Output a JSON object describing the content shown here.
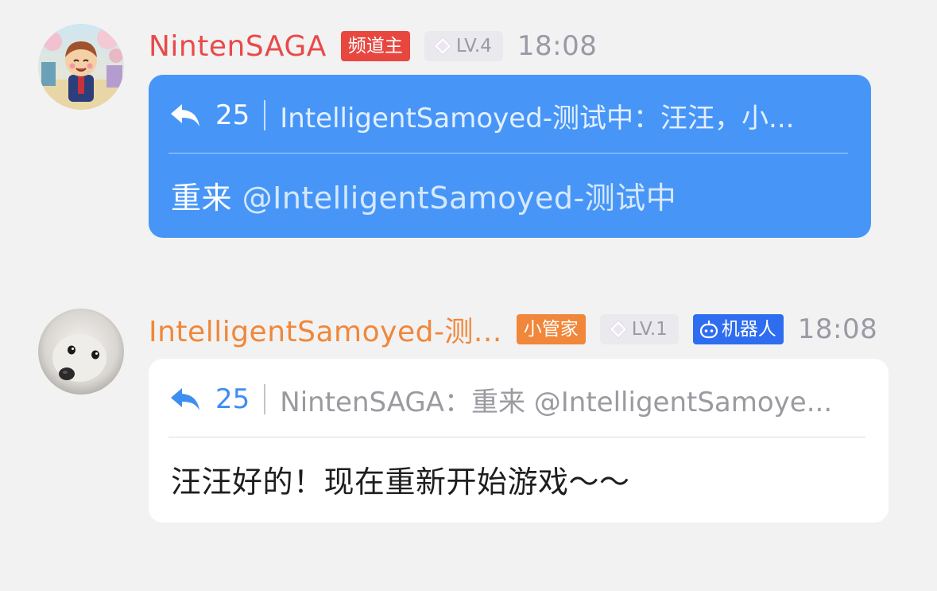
{
  "messages": [
    {
      "username": "NintenSAGA",
      "username_color": "#e84a4a",
      "role_badge": "频道主",
      "role_badge_color": "#e8473f",
      "level": "LV.4",
      "time": "18:08",
      "avatar_icon": "avatar-cartoon-villager",
      "bubble_color": "#4796f7",
      "quote": {
        "icon": "reply-icon",
        "count": "25",
        "text": "IntelligentSamoyed-测试中：汪汪，小..."
      },
      "body": {
        "text": "重来",
        "mention": "@IntelligentSamoyed-测试中"
      }
    },
    {
      "username": "IntelligentSamoyed-测...",
      "username_color": "#f0873a",
      "role_badge": "小管家",
      "role_badge_color": "#f0873a",
      "level": "LV.1",
      "bot_badge": "机器人",
      "bot_badge_color": "#2f6df0",
      "time": "18:08",
      "avatar_icon": "avatar-samoyed-dog",
      "bubble_color": "#ffffff",
      "quote": {
        "icon": "reply-icon",
        "count": "25",
        "text": "NintenSAGA：重来 @IntelligentSamoye..."
      },
      "body": {
        "text": "汪汪好的！现在重新开始游戏～～"
      }
    }
  ]
}
